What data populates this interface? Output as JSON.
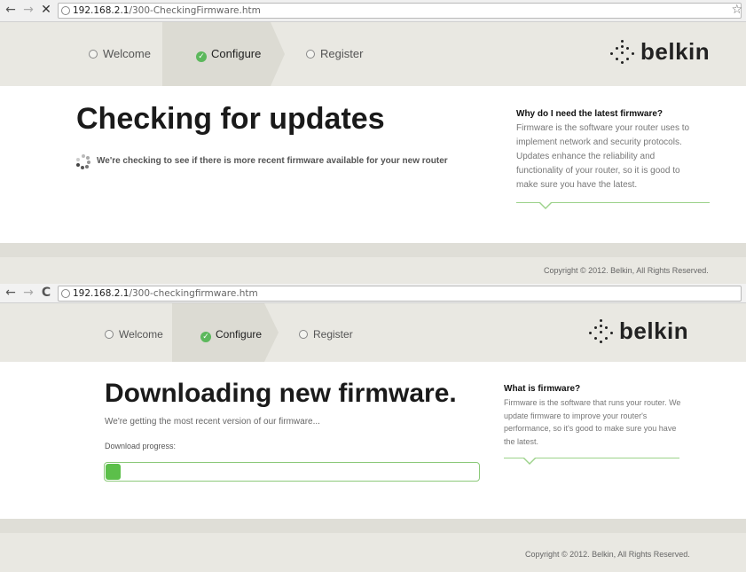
{
  "frame1": {
    "address": {
      "host": "192.168.2.1",
      "path": "/300-CheckingFirmware.htm"
    },
    "nav": {
      "back": "←",
      "forward": "→",
      "stop": "✕",
      "bookmark": "☆"
    },
    "steps": [
      {
        "label": "Welcome",
        "state": "pending"
      },
      {
        "label": "Configure",
        "state": "active"
      },
      {
        "label": "Register",
        "state": "pending"
      }
    ],
    "logo": "belkin",
    "heading": "Checking for updates",
    "status": "We're checking to see if there is more recent firmware available for your new router",
    "side": {
      "title": "Why do I need the latest firmware?",
      "body": "Firmware is the software your router uses to implement network and security protocols. Updates enhance the reliability and functionality of your router, so it is good to make sure you have the latest."
    },
    "copyright": "Copyright © 2012. Belkin, All Rights Reserved."
  },
  "frame2": {
    "address": {
      "host": "192.168.2.1",
      "path": "/300-checkingfirmware.htm"
    },
    "nav": {
      "back": "←",
      "forward": "→",
      "reload": "C"
    },
    "steps": [
      {
        "label": "Welcome",
        "state": "pending"
      },
      {
        "label": "Configure",
        "state": "active"
      },
      {
        "label": "Register",
        "state": "pending"
      }
    ],
    "logo": "belkin",
    "heading": "Downloading new firmware.",
    "status": "We're getting the most recent version of our firmware...",
    "progress_label": "Download progress:",
    "progress_fraction": 0.04,
    "side": {
      "title": "What is firmware?",
      "body": "Firmware is the software that runs your router. We update firmware to improve your router's performance, so it's good to make sure you have the latest."
    },
    "copyright": "Copyright © 2012. Belkin, All Rights Reserved."
  },
  "colors": {
    "accent_green": "#5cbf4a",
    "header_bg": "#e9e8e2",
    "active_step_bg": "#dcdbd3"
  },
  "icons": {
    "check": "✓"
  }
}
